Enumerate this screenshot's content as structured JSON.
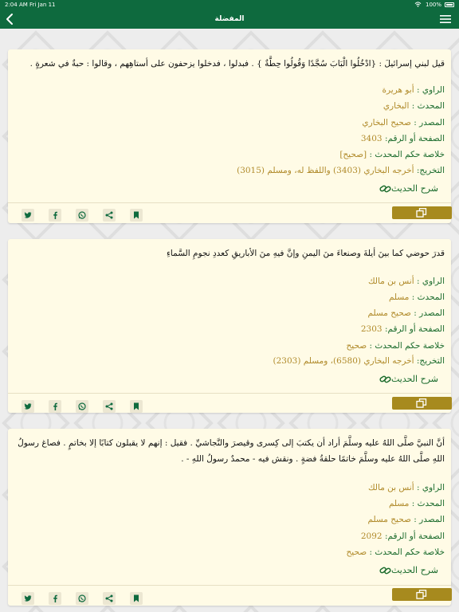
{
  "status_bar": {
    "time": "2:04 AM",
    "date": "Fri Jan 11",
    "battery": "100%",
    "wifi": "wifi-icon"
  },
  "nav": {
    "title": "المفضلة",
    "back_icon": "chevron-left-icon",
    "menu_icon": "hamburger-menu-icon"
  },
  "labels": {
    "narrator": "الراوي :",
    "muhaddith": "المحدث :",
    "source": "المصدر :",
    "page": "الصفحة أو الرقم:",
    "ruling": "خلاصة حكم المحدث :",
    "takhrij": "التخريج:",
    "sharh": "شرح الحديث"
  },
  "colors": {
    "brand_green": "#0e6a3e",
    "label_green": "#1a6b2c",
    "value_gold": "#b08a2a",
    "copy_button": "#a78a1e",
    "card_bg": "#fffbe6"
  },
  "action_icons": [
    "twitter-icon",
    "facebook-icon",
    "whatsapp-icon",
    "share-icon",
    "bookmark-icon"
  ],
  "hadiths": [
    {
      "text": "قيل لبني إسرائيلَ : {ادْخُلُوا الْبَابَ سُجَّدًا وَقُولُوا حِطَّةٌ } . فبدلوا ، فدخلوا يزحفون على أستاهِهم ، وقالوا : حبةٌ في شعرةٍ .",
      "narrator": "أبو هريرة",
      "muhaddith": "البخاري",
      "source": "صحيح البخاري",
      "page": "3403",
      "ruling": "[صحيح]",
      "takhrij": "أخرجه البخاري (3403) واللفظ له، ومسلم (3015)"
    },
    {
      "text": "قدرَ حوضي كما بينَ أيلةَ وصنعاءَ منَ اليمنِ وإنَّ فيهِ منَ الأباريقِ كعددِ نجومِ السَّماءِ",
      "narrator": "أنس بن مالك",
      "muhaddith": "مسلم",
      "source": "صحيح مسلم",
      "page": "2303",
      "ruling": "صحيح",
      "takhrij": "أخرجه البخاري (6580)، ومسلم (2303)"
    },
    {
      "text": "أنَّ النبيَّ صلَّى اللهُ عليه وسلَّمَ أراد أن يكتبَ إلى كِسرى وقيصرَ والنَّجاشيِّ . فقيل : إنهم لا يقبلون كتابًا إلا بخاتمٍ . فصاغ رسولُ اللهِ صلَّى اللهُ عليه وسلَّمَ خاتمًا حلقةُ فضةٍ . ونقش فيه - محمدٌ رسولُ اللهِ - .",
      "narrator": "أنس بن مالك",
      "muhaddith": "مسلم",
      "source": "صحيح مسلم",
      "page": "2092",
      "ruling": "صحيح"
    }
  ]
}
